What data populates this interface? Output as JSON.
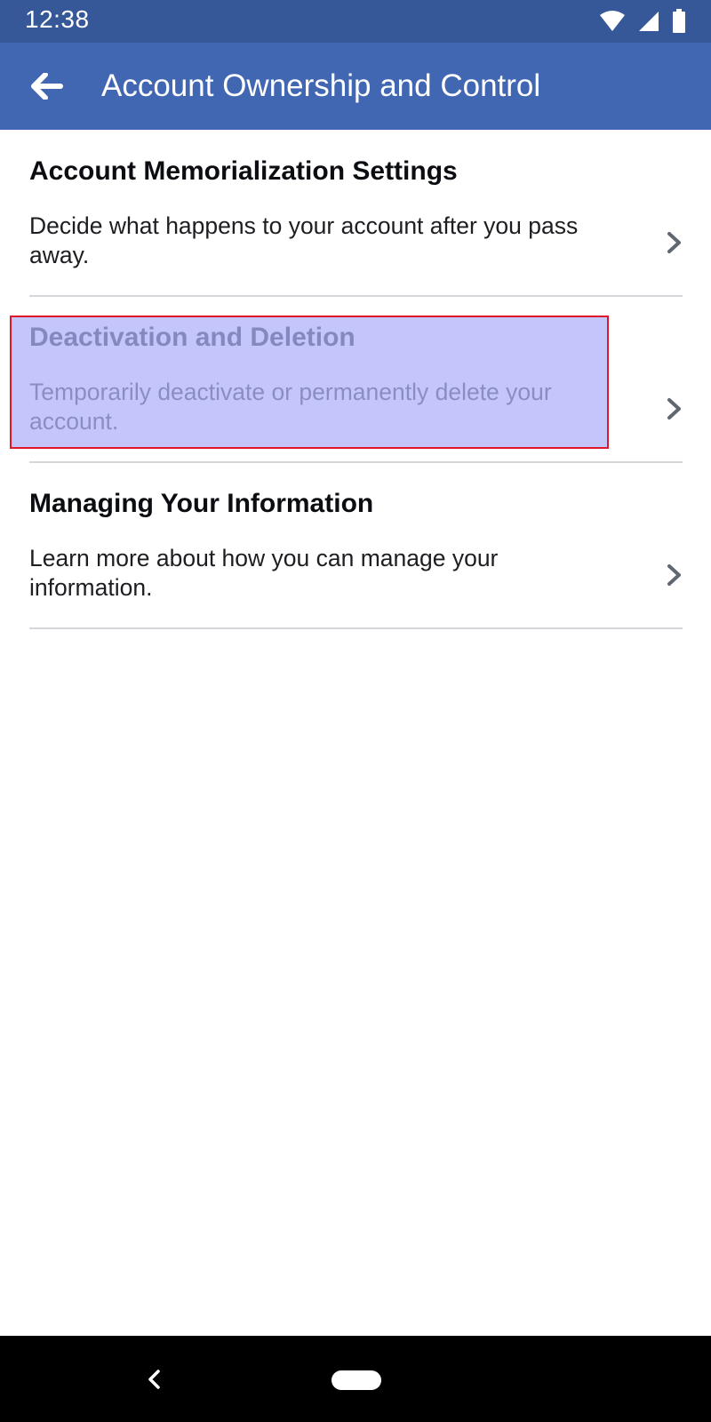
{
  "status_bar": {
    "time": "12:38",
    "icons": [
      "wifi-icon",
      "signal-icon",
      "battery-icon"
    ]
  },
  "app_bar": {
    "back_icon": "arrow-left-icon",
    "title": "Account Ownership and Control",
    "color": "#4267b2"
  },
  "items": [
    {
      "title": "Account Memorialization Settings",
      "description": "Decide what happens to your account after you pass away.",
      "chevron_icon": "chevron-right-icon"
    },
    {
      "title": "Deactivation and Deletion",
      "description": "Temporarily deactivate or permanently delete your account.",
      "chevron_icon": "chevron-right-icon",
      "highlighted": true
    },
    {
      "title": "Managing Your Information",
      "description": "Learn more about how you can manage your information.",
      "chevron_icon": "chevron-right-icon"
    }
  ],
  "colors": {
    "status_bar": "#365899",
    "highlight_fill": "#afb2fa",
    "highlight_border": "#e0162b"
  },
  "nav_bar": {
    "icons": [
      "nav-back-icon",
      "nav-home-pill"
    ]
  }
}
